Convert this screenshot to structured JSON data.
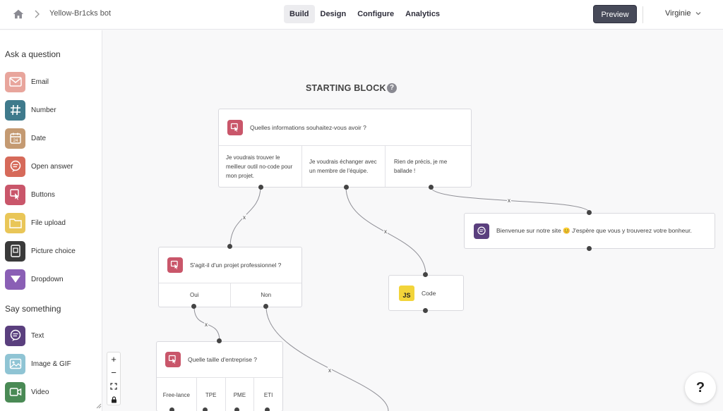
{
  "header": {
    "bot_name": "Yellow-Br1cks bot",
    "tabs": [
      {
        "label": "Build",
        "active": true
      },
      {
        "label": "Design",
        "active": false
      },
      {
        "label": "Configure",
        "active": false
      },
      {
        "label": "Analytics",
        "active": false
      }
    ],
    "preview_label": "Preview",
    "user_name": "Virginie"
  },
  "sidebar": {
    "ask_title": "Ask a question",
    "ask_items": [
      {
        "label": "Email",
        "icon": "email-icon",
        "color": "#e8a59c"
      },
      {
        "label": "Number",
        "icon": "hash-icon",
        "color": "#3f7a8c"
      },
      {
        "label": "Date",
        "icon": "calendar-icon",
        "color": "#c49a72"
      },
      {
        "label": "Open answer",
        "icon": "speech-icon",
        "color": "#d66a5a"
      },
      {
        "label": "Buttons",
        "icon": "cursor-click-icon",
        "color": "#c9566a"
      },
      {
        "label": "File upload",
        "icon": "folder-icon",
        "color": "#e9c658"
      },
      {
        "label": "Picture choice",
        "icon": "picture-choice-icon",
        "color": "#3a3a3a"
      },
      {
        "label": "Dropdown",
        "icon": "dropdown-icon",
        "color": "#8a5fb5"
      }
    ],
    "say_title": "Say something",
    "say_items": [
      {
        "label": "Text",
        "icon": "chat-icon",
        "color": "#5a3f7e"
      },
      {
        "label": "Image & GIF",
        "icon": "image-icon",
        "color": "#8fc4d4"
      },
      {
        "label": "Video",
        "icon": "video-icon",
        "color": "#4a8a55"
      }
    ]
  },
  "canvas": {
    "start_title": "STARTING BLOCK",
    "help_glyph": "?",
    "start_block": {
      "question": "Quelles informations souhaitez-vous avoir ?",
      "options": [
        "Je voudrais trouver le meilleur outil no-code pour mon projet.",
        "Je voudrais échanger avec un membre de l'équipe.",
        "Rien de précis, je me ballade !"
      ]
    },
    "welcome_block": {
      "text": "Bienvenue sur notre site 😊 J'espère que vous y trouverez votre bonheur."
    },
    "pro_block": {
      "question": "S'agit-il d'un projet professionnel ?",
      "options": [
        "Oui",
        "Non"
      ]
    },
    "code_block": {
      "badge": "JS",
      "label": "Code"
    },
    "size_block": {
      "question": "Quelle taille d'entreprise ?",
      "options": [
        "Free-lance",
        "TPE",
        "PME",
        "ETI"
      ]
    },
    "edge_mark": "x"
  },
  "zoom_controls": {
    "zoom_in": "+",
    "zoom_out": "−"
  },
  "help_fab": "?"
}
